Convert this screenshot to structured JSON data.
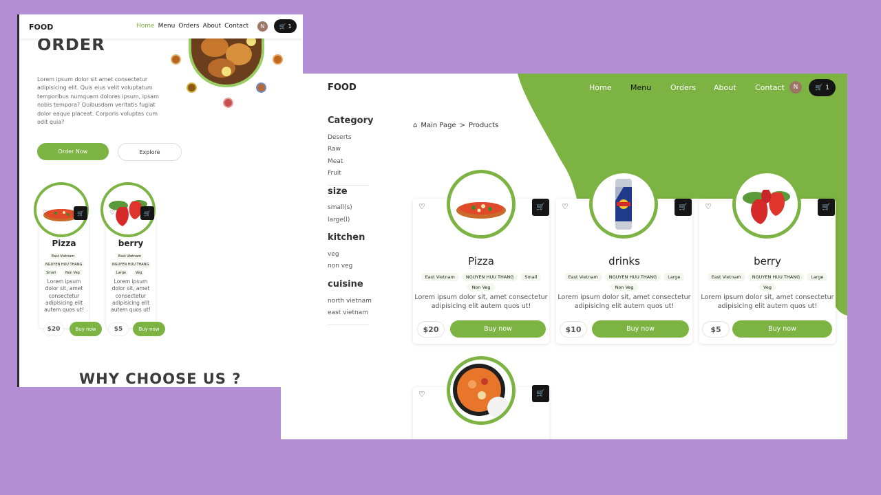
{
  "colors": {
    "accent": "#7cb342",
    "background": "#b48fd6",
    "dark": "#151515"
  },
  "left_window": {
    "logo": "FOOD",
    "nav": [
      "Home",
      "Menu",
      "Orders",
      "About",
      "Contact"
    ],
    "avatar": "N",
    "cart_count": "1",
    "hero_title": "ORDER",
    "hero_text": "Lorem ipsum dolor sit amet consectetur adipisicing elit. Quis eius velit voluptatum temporibus numquam dolores ipsum, ipsam nobis tempora? Quibusdam veritatis fugiat dolor eaque placeat. Corporis voluptas cum odit quia?",
    "order_button": "Order Now",
    "explore_button": "Explore",
    "products": [
      {
        "name": "Pizza",
        "tags": [
          "East Vietnam",
          "NGUYEN HUU THANG",
          "Small",
          "Non Veg"
        ],
        "desc": "Lorem ipsum dolor sit, amet consectetur adipisicing elit autem quos ut!",
        "price": "$20",
        "buy": "Buy now"
      },
      {
        "name": "berry",
        "tags": [
          "East Vietnam",
          "NGUYEN HUU THANG",
          "Large",
          "Veg"
        ],
        "desc": "Lorem ipsum dolor sit, amet consectetur adipisicing elit autem quos ut!",
        "price": "$5",
        "buy": "Buy now"
      }
    ],
    "why_title": "WHY CHOOSE US ?"
  },
  "right_window": {
    "logo": "FOOD",
    "nav": [
      "Home",
      "Menu",
      "Orders",
      "About",
      "Contact"
    ],
    "avatar": "N",
    "cart_count": "1",
    "sidebar": {
      "category_title": "Category",
      "category_items": [
        "Deserts",
        "Raw",
        "Meat",
        "Fruit"
      ],
      "size_title": "size",
      "size_items": [
        "small(s)",
        "large(l)"
      ],
      "kitchen_title": "kitchen",
      "kitchen_items": [
        "veg",
        "non veg"
      ],
      "cuisine_title": "cuisine",
      "cuisine_items": [
        "north vietnam",
        "east vietnam"
      ]
    },
    "breadcrumb": {
      "home": "Main Page",
      "separator": ">",
      "current": "Products"
    },
    "products": [
      {
        "name": "Pizza",
        "tags": [
          "East Vietnam",
          "NGUYEN HUU THANG",
          "Small",
          "Non Veg"
        ],
        "desc": "Lorem ipsum dolor sit, amet consectetur adipisicing elit autem quos ut!",
        "price": "$20",
        "buy": "Buy now"
      },
      {
        "name": "drinks",
        "tags": [
          "East Vietnam",
          "NGUYEN HUU THANG",
          "Large",
          "Non Veg"
        ],
        "desc": "Lorem ipsum dolor sit, amet consectetur adipisicing elit autem quos ut!",
        "price": "$10",
        "buy": "Buy now"
      },
      {
        "name": "berry",
        "tags": [
          "East Vietnam",
          "NGUYEN HUU THANG",
          "Large",
          "Veg"
        ],
        "desc": "Lorem ipsum dolor sit, amet consectetur adipisicing elit autem quos ut!",
        "price": "$5",
        "buy": "Buy now"
      }
    ]
  }
}
